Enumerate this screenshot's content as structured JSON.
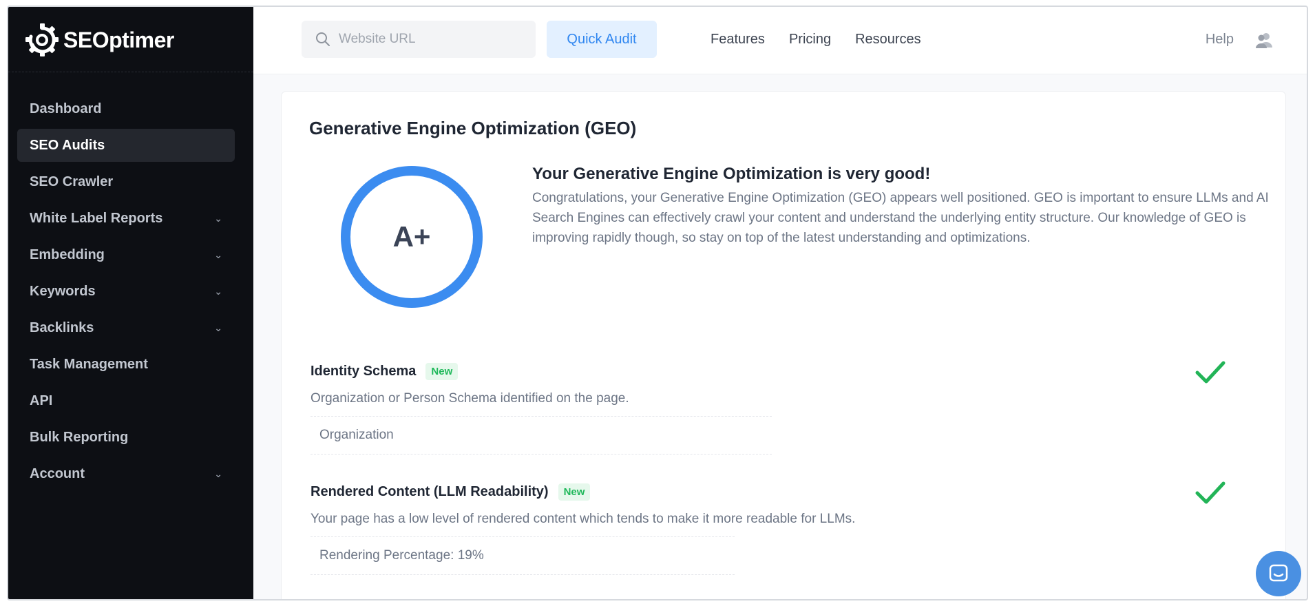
{
  "brand": {
    "name": "SEOptimer"
  },
  "sidebar": {
    "items": [
      {
        "label": "Dashboard",
        "has_chevron": false,
        "active": false
      },
      {
        "label": "SEO Audits",
        "has_chevron": false,
        "active": true
      },
      {
        "label": "SEO Crawler",
        "has_chevron": false,
        "active": false
      },
      {
        "label": "White Label Reports",
        "has_chevron": true,
        "active": false
      },
      {
        "label": "Embedding",
        "has_chevron": true,
        "active": false
      },
      {
        "label": "Keywords",
        "has_chevron": true,
        "active": false
      },
      {
        "label": "Backlinks",
        "has_chevron": true,
        "active": false
      },
      {
        "label": "Task Management",
        "has_chevron": false,
        "active": false
      },
      {
        "label": "API",
        "has_chevron": false,
        "active": false
      },
      {
        "label": "Bulk Reporting",
        "has_chevron": false,
        "active": false
      },
      {
        "label": "Account",
        "has_chevron": true,
        "active": false
      }
    ]
  },
  "topbar": {
    "search_placeholder": "Website URL",
    "search_value": "",
    "quick_audit_label": "Quick Audit",
    "nav": [
      "Features",
      "Pricing",
      "Resources"
    ],
    "help_label": "Help"
  },
  "geo": {
    "title": "Generative Engine Optimization (GEO)",
    "grade": "A+",
    "summary_heading": "Your Generative Engine Optimization is very good!",
    "summary_text": "Congratulations, your Generative Engine Optimization (GEO) appears well positioned. GEO is important to ensure LLMs and AI Search Engines can effectively crawl your content and understand the underlying entity structure. Our knowledge of GEO is improving rapidly though, so stay on top of the latest understanding and optimizations.",
    "checks": [
      {
        "title": "Identity Schema",
        "badge": "New",
        "description": "Organization or Person Schema identified on the page.",
        "detail": "Organization",
        "status": "pass"
      },
      {
        "title": "Rendered Content (LLM Readability)",
        "badge": "New",
        "description": "Your page has a low level of rendered content which tends to make it more readable for LLMs.",
        "detail": "Rendering Percentage: 19%",
        "status": "pass"
      }
    ]
  },
  "colors": {
    "accent": "#3b8cf0",
    "sidebar_bg": "#0d0f14",
    "pass": "#22b457",
    "badge_bg": "#e6f8ec"
  },
  "icons": {
    "logo": "gear-logo-icon",
    "search": "search-icon",
    "user": "users-icon",
    "check": "checkmark-icon",
    "chat": "chat-icon",
    "chevron": "chevron-down-icon"
  }
}
